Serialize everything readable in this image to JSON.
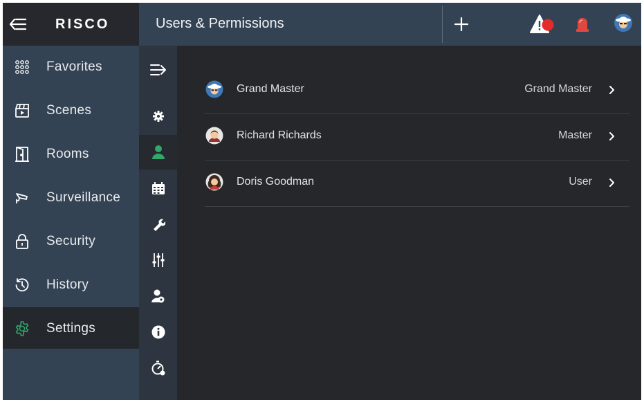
{
  "app": {
    "logo_text": "RISCO",
    "colors": {
      "sidebar_bg": "#344354",
      "header_bg": "#26282d",
      "content_bg": "#25272b",
      "accent_green": "#2fa86a",
      "alert_red": "#e32b2b"
    }
  },
  "header": {
    "title": "Users & Permissions",
    "icons": [
      "back-arrow-icon",
      "plus-icon",
      "warning-alert-icon",
      "siren-icon",
      "user-avatar-icon"
    ]
  },
  "sidebar": {
    "items": [
      {
        "label": "Favorites",
        "icon": "grid-icon"
      },
      {
        "label": "Scenes",
        "icon": "clapperboard-icon"
      },
      {
        "label": "Rooms",
        "icon": "door-icon"
      },
      {
        "label": "Surveillance",
        "icon": "camera-icon"
      },
      {
        "label": "Security",
        "icon": "lock-icon"
      },
      {
        "label": "History",
        "icon": "history-icon"
      },
      {
        "label": "Settings",
        "icon": "gear-icon",
        "active": true
      }
    ]
  },
  "subnav": {
    "items": [
      {
        "icon": "collapse-arrow-icon"
      },
      {
        "icon": "gear-icon"
      },
      {
        "icon": "user-icon",
        "active": true
      },
      {
        "icon": "calendar-icon"
      },
      {
        "icon": "wrench-icon"
      },
      {
        "icon": "sliders-icon"
      },
      {
        "icon": "user-settings-icon"
      },
      {
        "icon": "info-icon"
      },
      {
        "icon": "timer-icon"
      }
    ]
  },
  "users": [
    {
      "name": "Grand Master",
      "role": "Grand Master",
      "avatar": "cowboy-avatar-icon"
    },
    {
      "name": "Richard Richards",
      "role": "Master",
      "avatar": "man-avatar-icon"
    },
    {
      "name": "Doris Goodman",
      "role": "User",
      "avatar": "woman-avatar-icon"
    }
  ]
}
